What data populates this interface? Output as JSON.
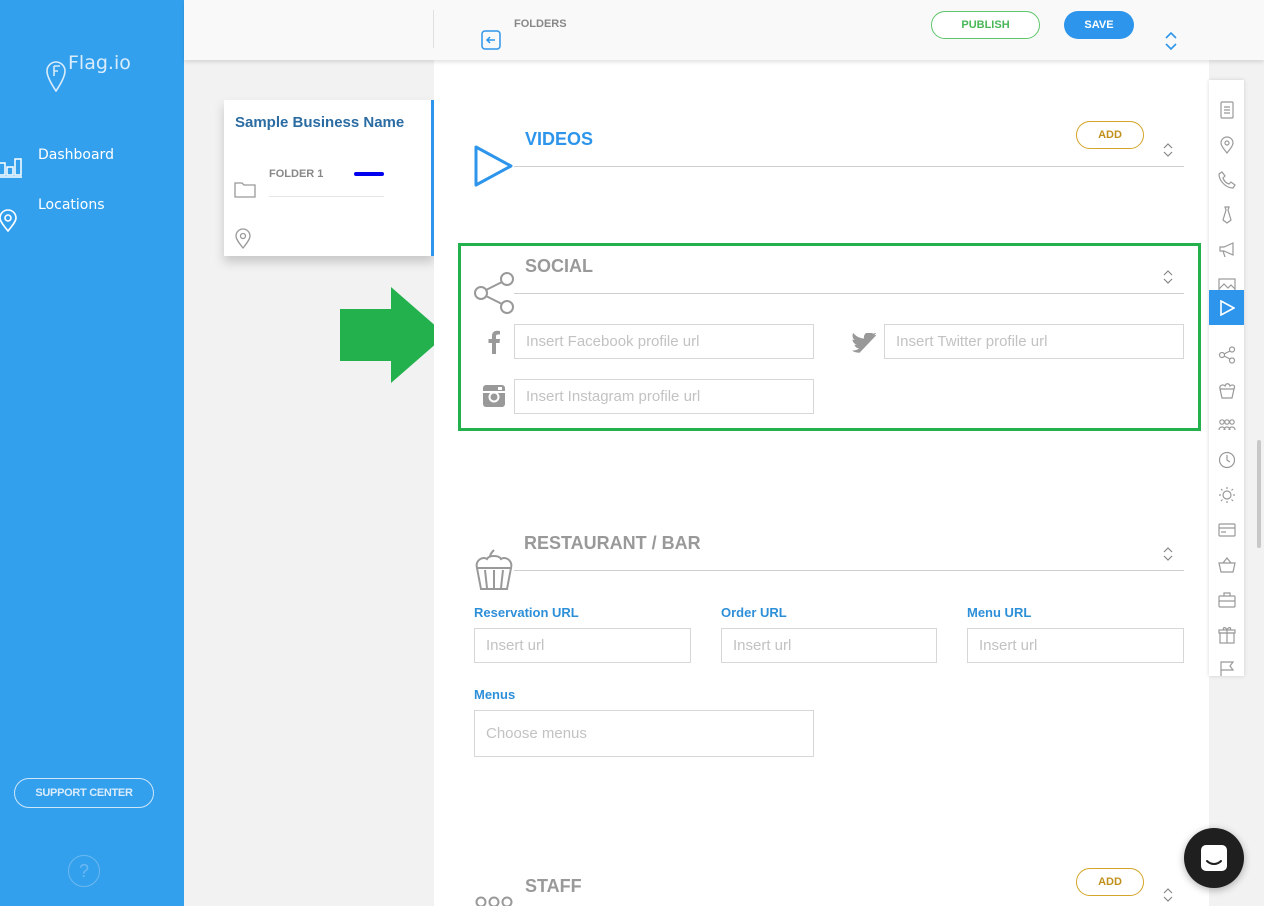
{
  "sidebar": {
    "brand": "Flag.io",
    "nav": [
      {
        "label": "Dashboard",
        "icon": "dashboard-icon"
      },
      {
        "label": "Locations",
        "icon": "location-pin-icon"
      }
    ],
    "support_label": "SUPPORT CENTER",
    "help_label": "?"
  },
  "topbar": {
    "breadcrumb": "FOLDERS",
    "publish_label": "PUBLISH",
    "save_label": "SAVE"
  },
  "folder_card": {
    "business_name": "Sample Business Name",
    "folder_label": "FOLDER 1"
  },
  "sections": {
    "videos": {
      "title": "VIDEOS",
      "add_label": "ADD"
    },
    "social": {
      "title": "SOCIAL",
      "facebook_placeholder": "Insert Facebook profile url",
      "twitter_placeholder": "Insert Twitter profile url",
      "instagram_placeholder": "Insert Instagram profile url"
    },
    "restaurant": {
      "title": "RESTAURANT / BAR",
      "reservation_label": "Reservation URL",
      "order_label": "Order URL",
      "menu_label": "Menu URL",
      "url_placeholder": "Insert url",
      "menus_label": "Menus",
      "menus_placeholder": "Choose menus"
    },
    "staff": {
      "title": "STAFF",
      "add_label": "ADD"
    }
  },
  "rail_icons": [
    "document-icon",
    "location-pin-icon",
    "phone-icon",
    "tie-icon",
    "megaphone-icon",
    "image-icon",
    "play-icon",
    "share-icon",
    "cupcake-icon",
    "people-icon",
    "clock-icon",
    "sun-icon",
    "credit-card-icon",
    "basket-icon",
    "briefcase-icon",
    "gift-icon",
    "flag-icon"
  ],
  "colors": {
    "sidebar": "#33a0ee",
    "accent": "#2d95eb",
    "publish": "#49b758",
    "add": "#c1901c",
    "highlight": "#22b14c"
  }
}
